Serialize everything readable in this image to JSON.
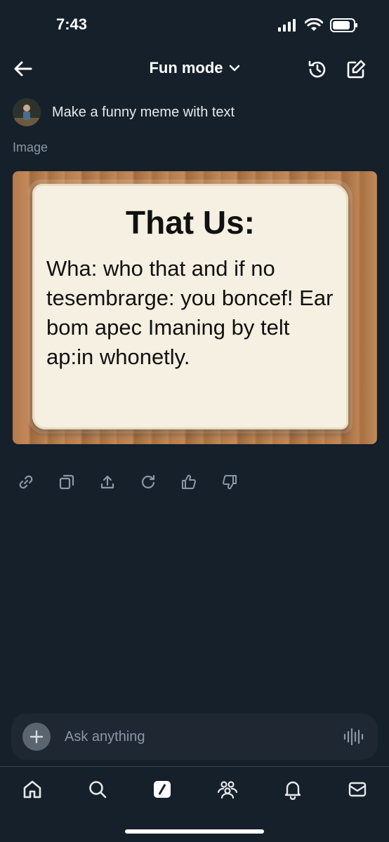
{
  "status": {
    "time": "7:43"
  },
  "header": {
    "title": "Fun mode"
  },
  "prompt": {
    "text": "Make a funny meme with text"
  },
  "result": {
    "label": "Image",
    "meme_title": "That Us:",
    "meme_body": "Wha: who that and if no tesembrarge: you boncef! Ear bom apec Imaning by telt ap:in whonetly."
  },
  "composer": {
    "placeholder": "Ask anything"
  },
  "icons": {
    "header": [
      "back-arrow-icon",
      "chevron-down-icon",
      "history-icon",
      "new-chat-icon"
    ],
    "actions": [
      "link-icon",
      "copy-icon",
      "share-icon",
      "regenerate-icon",
      "thumbs-up-icon",
      "thumbs-down-icon"
    ],
    "tabbar": [
      "home-icon",
      "search-icon",
      "grok-icon",
      "communities-icon",
      "notifications-icon",
      "messages-icon"
    ]
  },
  "colors": {
    "background": "#15202b",
    "text": "#e7e9ea",
    "muted": "#8b98a5",
    "composer": "#1e2732"
  }
}
